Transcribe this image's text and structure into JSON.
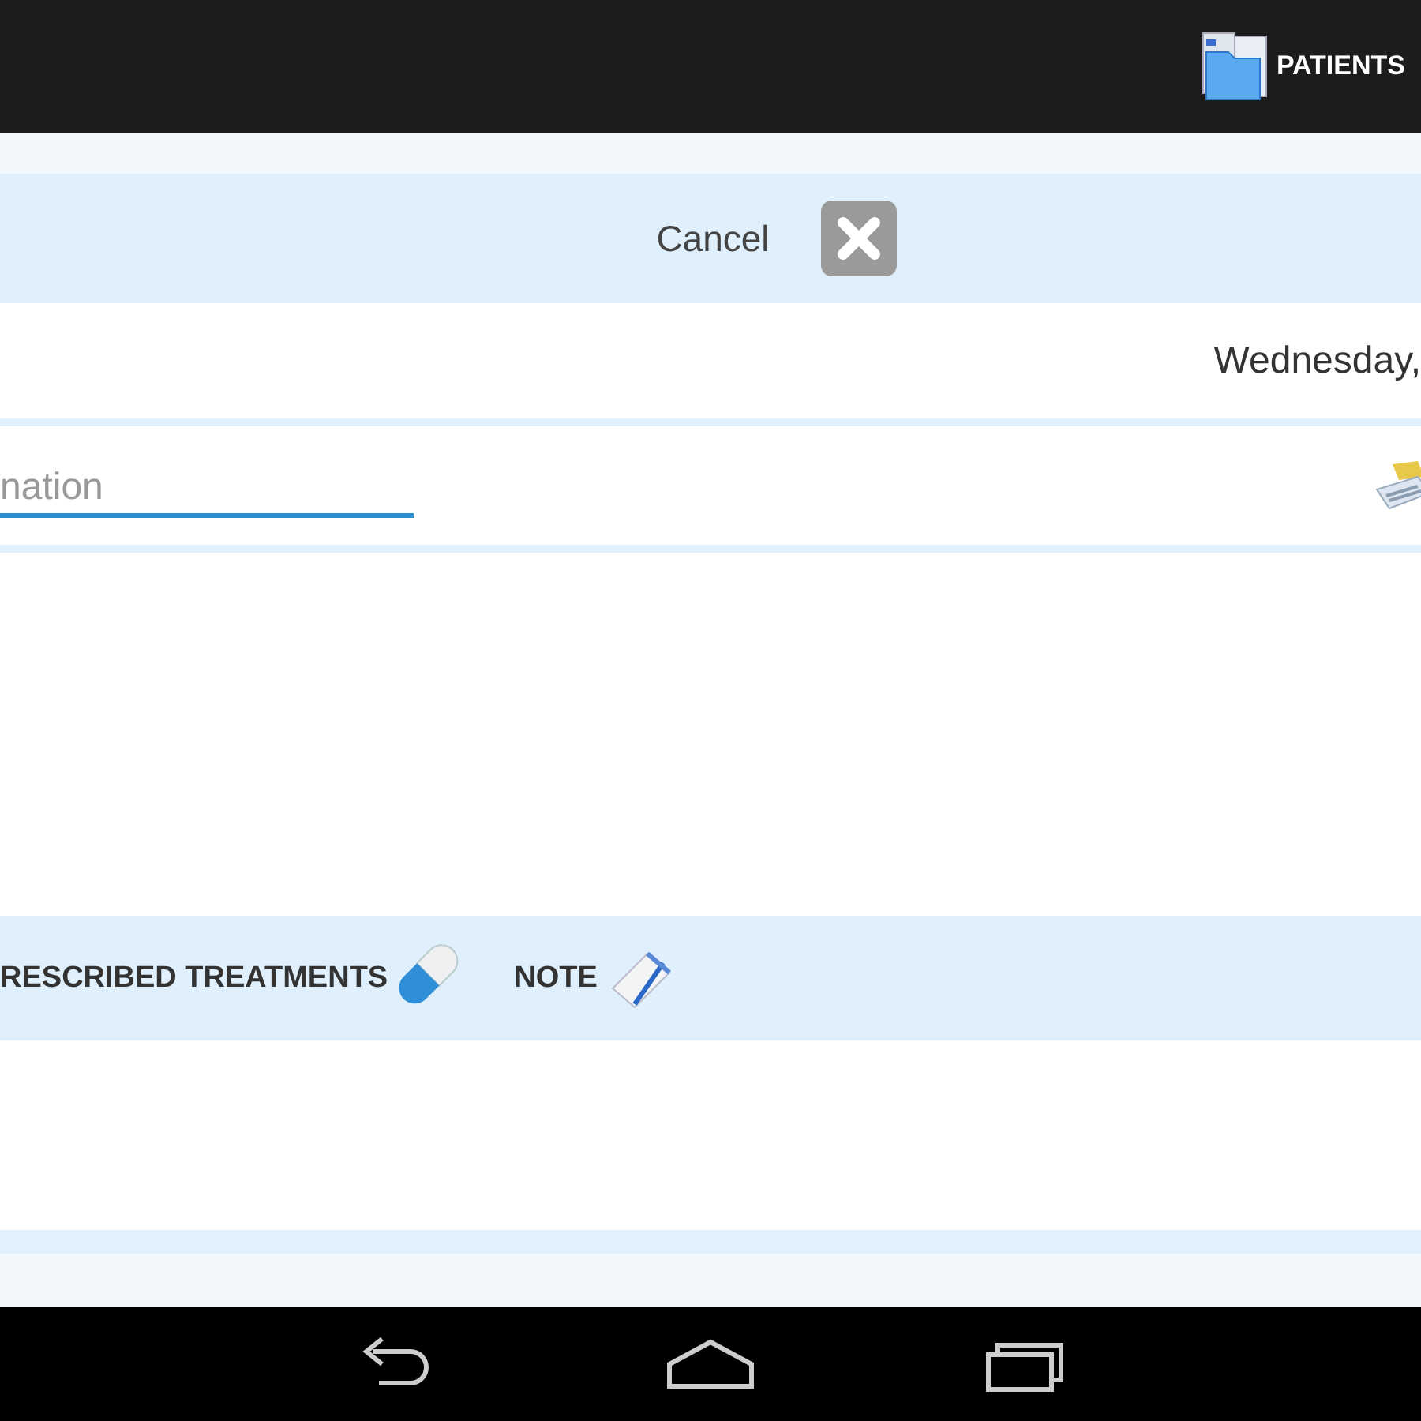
{
  "action_bar": {
    "title": "PATIENTS"
  },
  "cancel_button": {
    "label": "Cancel"
  },
  "date": "Wednesday,",
  "field": {
    "placeholder": "nation"
  },
  "tabs": [
    {
      "label": "RESCRIBED TREATMENTS",
      "kind": "pill"
    },
    {
      "label": "NOTE",
      "kind": "note"
    }
  ]
}
